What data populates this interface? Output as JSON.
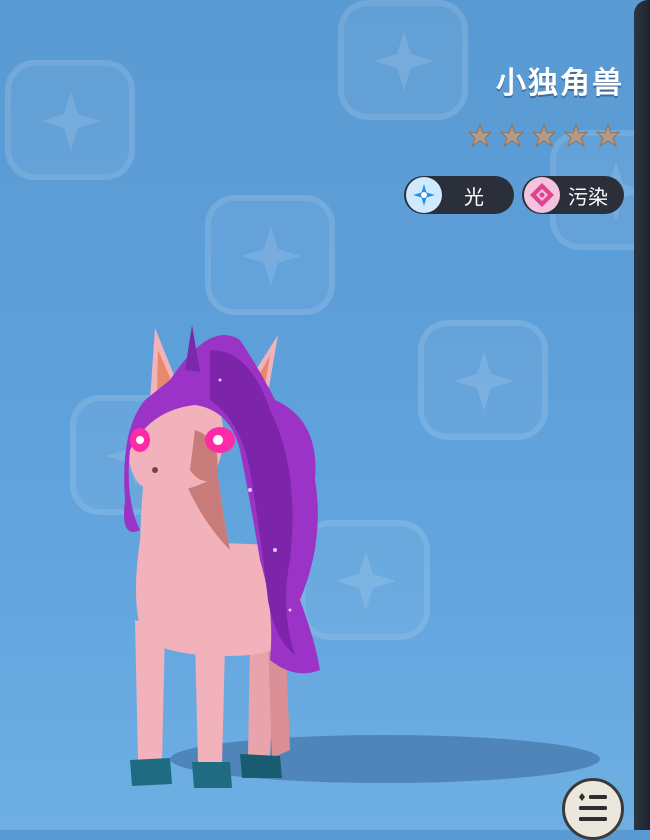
{
  "creature": {
    "name": "小独角兽",
    "star_count": 5,
    "star_color": "#b49a86"
  },
  "elements": [
    {
      "label": "光",
      "icon": "light-element-icon",
      "color": "#2a8fe0"
    },
    {
      "label": "污染",
      "icon": "pollution-element-icon",
      "color": "#e0438f"
    }
  ],
  "menu": {
    "icon": "menu-list-icon"
  },
  "background": {
    "pattern": "sparkle-tile-pattern",
    "color": "#5d9fd9"
  }
}
